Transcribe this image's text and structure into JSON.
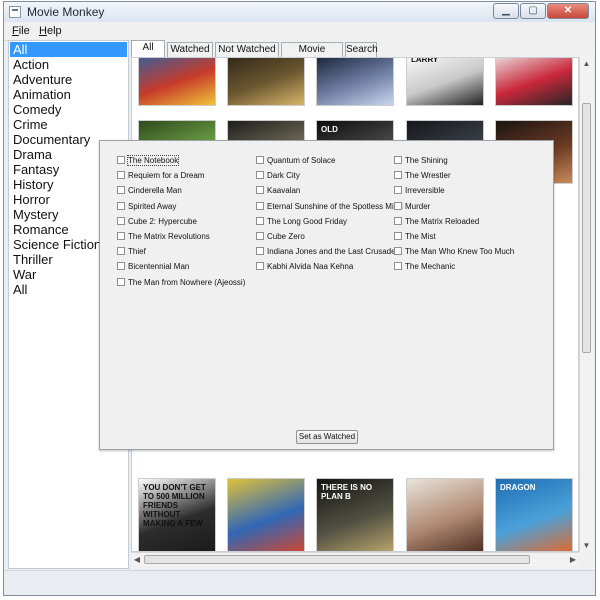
{
  "window": {
    "title": "Movie Monkey"
  },
  "menubar": {
    "file": {
      "mnemonic": "F",
      "rest": "ile"
    },
    "help": {
      "mnemonic": "H",
      "rest": "elp"
    }
  },
  "genres": [
    "All",
    "Action",
    "Adventure",
    "Animation",
    "Comedy",
    "Crime",
    "Documentary",
    "Drama",
    "Fantasy",
    "History",
    "Horror",
    "Mystery",
    "Romance",
    "Science Fiction",
    "Thriller",
    "War",
    "All"
  ],
  "tabs": [
    "All",
    "Watched",
    "Not Watched",
    "Movie Details",
    "Search"
  ],
  "dialog": {
    "movies": [
      [
        "The Notebook",
        "Requiem for a Dream",
        "Cinderella Man",
        "Spirited Away",
        "Cube 2: Hypercube",
        "The Matrix Revolutions",
        "Thief",
        "Bicentennial Man",
        "The Man from Nowhere (Ajeossi)"
      ],
      [
        "Quantum of Solace",
        "Dark City",
        "Kaavalan",
        "Eternal Sunshine of the Spotless Mind",
        "The Long Good Friday",
        "Cube Zero",
        "Indiana Jones and the Last Crusade",
        "Kabhi Alvida Naa Kehna"
      ],
      [
        "The Shining",
        "The Wrestler",
        "Irreversible",
        "Murder",
        "The Matrix Reloaded",
        "The Mist",
        "The Man Who Knew Too Much",
        "The Mechanic"
      ]
    ],
    "button_label": "Set as Watched"
  },
  "posters": {
    "row_top": [
      {
        "colors": [
          "#2b63a8",
          "#c63b2a",
          "#f2c23b"
        ]
      },
      {
        "colors": [
          "#2a2116",
          "#6b5730",
          "#d8b56a"
        ]
      },
      {
        "colors": [
          "#0f1a2d",
          "#6c7ba0",
          "#c9d5ee"
        ]
      },
      {
        "colors": [
          "#ffffff",
          "#c9c9c9",
          "#222222"
        ],
        "text": "LARRY"
      },
      {
        "colors": [
          "#efefef",
          "#c9283b",
          "#262626"
        ]
      }
    ],
    "row_second": [
      {
        "colors": [
          "#2f4a1e",
          "#6ca044",
          "#b9d66e"
        ]
      },
      {
        "colors": [
          "#1e1e1c",
          "#6f6a56",
          "#c7b98d"
        ]
      },
      {
        "colors": [
          "#0c0c0c",
          "#4b4b4b",
          "#a4a4a4"
        ],
        "text": "OLD"
      },
      {
        "colors": [
          "#14161a",
          "#3c414a",
          "#8a8f99"
        ]
      },
      {
        "colors": [
          "#1b1410",
          "#6b3a23",
          "#c98a5a"
        ]
      }
    ],
    "row_bottom": [
      {
        "colors": [
          "#ffffff",
          "#2d2d2d",
          "#1a1a1a"
        ],
        "text": "YOU DON'T GET TO 500 MILLION FRIENDS WITHOUT MAKING A FEW"
      },
      {
        "colors": [
          "#e1c13a",
          "#3167b5",
          "#d1472f"
        ]
      },
      {
        "colors": [
          "#141414",
          "#505042",
          "#bba66d"
        ],
        "text": "THERE IS NO PLAN B"
      },
      {
        "colors": [
          "#e9e3da",
          "#b08a73",
          "#4a2c1f"
        ]
      },
      {
        "colors": [
          "#1f6db3",
          "#4aa1d9",
          "#e3692a"
        ],
        "text": "DRAGON"
      }
    ]
  }
}
